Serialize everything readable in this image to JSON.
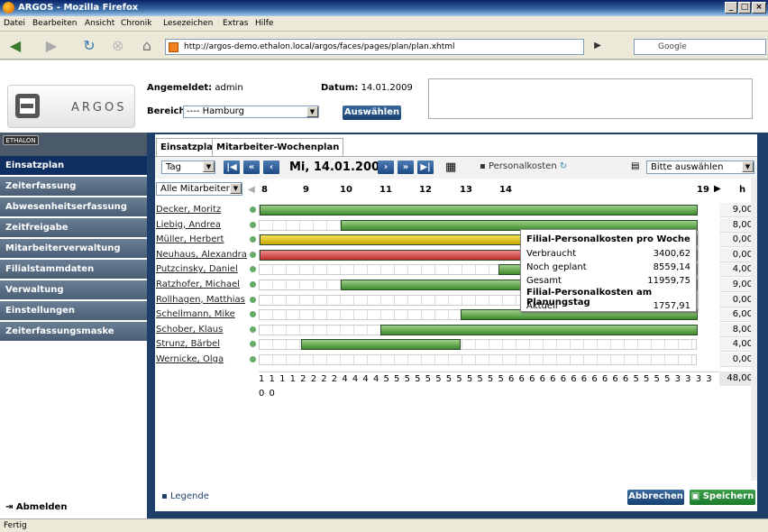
{
  "window": {
    "title": "ARGOS - Mozilla Firefox"
  },
  "menu": [
    "Datei",
    "Bearbeiten",
    "Ansicht",
    "Chronik",
    "Lesezeichen",
    "Extras",
    "Hilfe"
  ],
  "url": "http://argos-demo.ethalon.local/argos/faces/pages/plan/plan.xhtml",
  "search_placeholder": "Google",
  "logo": {
    "text": "ARGOS",
    "badge": "ETHALON"
  },
  "header": {
    "angemeldet_label": "Angemeldet:",
    "angemeldet_value": "admin",
    "datum_label": "Datum:",
    "datum_value": "14.01.2009",
    "bereich_label": "Bereich",
    "bereich_value": "---- Hamburg",
    "auswaehlen": "Auswählen"
  },
  "sidebar": {
    "items": [
      "Einsatzplan",
      "Zeiterfassung",
      "Abwesenheitserfassung",
      "Zeitfreigabe",
      "Mitarbeiterverwaltung",
      "Filialstammdaten",
      "Verwaltung",
      "Einstellungen",
      "Zeiterfassungsmaske"
    ],
    "active": "Einsatzplan",
    "logout": "Abmelden"
  },
  "tabs": [
    "Einsatzplan",
    "Mitarbeiter-Wochenplan"
  ],
  "toolbar": {
    "view": "Tag",
    "date": "Mi, 14.01.2009",
    "personalkosten": "Personalkosten",
    "bitte": "Bitte auswählen",
    "filter": "Alle Mitarbeiter",
    "hours_label": "h"
  },
  "hours": [
    "8",
    "9",
    "10",
    "11",
    "12",
    "13",
    "14",
    "19"
  ],
  "employees": [
    {
      "name": "Decker, Moritz",
      "hours": "9,00",
      "color": "green"
    },
    {
      "name": "Liebig, Andrea",
      "hours": "8,00",
      "color": "green"
    },
    {
      "name": "Müller, Herbert",
      "hours": "0,00",
      "color": "yellow"
    },
    {
      "name": "Neuhaus, Alexandra",
      "hours": "0,00",
      "color": "red"
    },
    {
      "name": "Putzcinsky, Daniel",
      "hours": "4,00",
      "color": "green"
    },
    {
      "name": "Ratzhofer, Michael",
      "hours": "9,00",
      "color": "green"
    },
    {
      "name": "Rollhagen, Matthias",
      "hours": "0,00",
      "color": "none"
    },
    {
      "name": "Schellmann, Mike",
      "hours": "6,00",
      "color": "green"
    },
    {
      "name": "Schober, Klaus",
      "hours": "8,00",
      "color": "green"
    },
    {
      "name": "Strunz, Bärbel",
      "hours": "4,00",
      "color": "green"
    },
    {
      "name": "Wernicke, Olga",
      "hours": "0,00",
      "color": "none"
    }
  ],
  "counts": "1 1 1 1 2 2 2 2 4 4 4 4 5 5 5 5 5 5 5 5 5 5 5 5 6 6 6 6 6 6 6 6 6 6 6 6 5 5 5 5 3 3 3 3 0 0",
  "total_hours": "48,00",
  "popup": {
    "title1": "Filial-Personalkosten pro Woche",
    "rows1": [
      {
        "k": "Verbraucht",
        "v": "3400,62"
      },
      {
        "k": "Noch geplant",
        "v": "8559,14"
      },
      {
        "k": "Gesamt",
        "v": "11959,75"
      }
    ],
    "title2": "Filial-Personalkosten am Planungstag",
    "rows2": [
      {
        "k": "Aktuell",
        "v": "1757,91"
      }
    ]
  },
  "footer": {
    "legende": "Legende",
    "abbrechen": "Abbrechen",
    "speichern": "Speichern"
  },
  "status": "Fertig"
}
